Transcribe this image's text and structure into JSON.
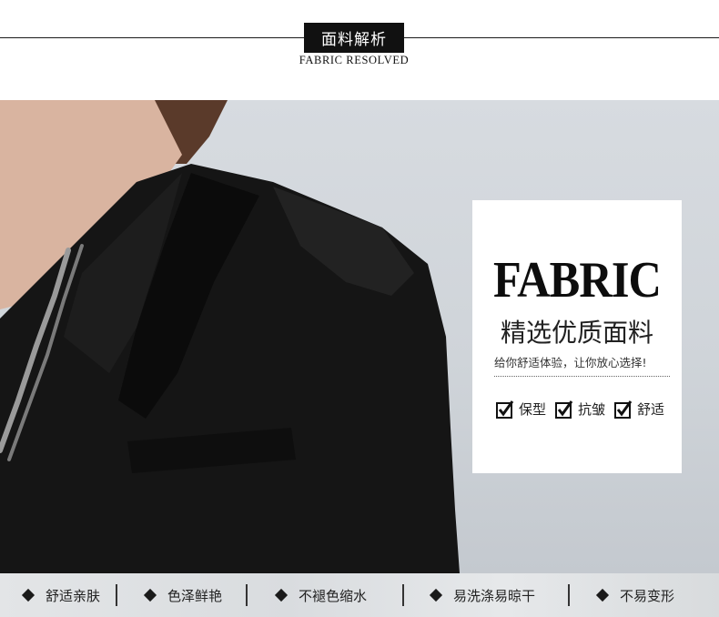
{
  "header": {
    "title_cn": "面料解析",
    "subtitle_en": "FABRIC RESOLVED"
  },
  "card": {
    "headline": "FABRIC",
    "cn_title": "精选优质面料",
    "slogan": "给你舒适体验，让你放心选择!",
    "checks": [
      {
        "label": "保型",
        "icon": "checkbox-checked-icon"
      },
      {
        "label": "抗皱",
        "icon": "checkbox-checked-icon"
      },
      {
        "label": "舒适",
        "icon": "checkbox-checked-icon"
      }
    ]
  },
  "features": [
    {
      "label": "舒适亲肤",
      "icon": "diamond-icon"
    },
    {
      "label": "色泽鲜艳",
      "icon": "diamond-icon"
    },
    {
      "label": "不褪色缩水",
      "icon": "diamond-icon"
    },
    {
      "label": "易洗涤易晾干",
      "icon": "diamond-icon"
    },
    {
      "label": "不易变形",
      "icon": "diamond-icon"
    }
  ],
  "colors": {
    "title_bg": "#111111",
    "jacket": "#141414",
    "background": "#d3d7dc",
    "card_bg": "#ffffff"
  }
}
